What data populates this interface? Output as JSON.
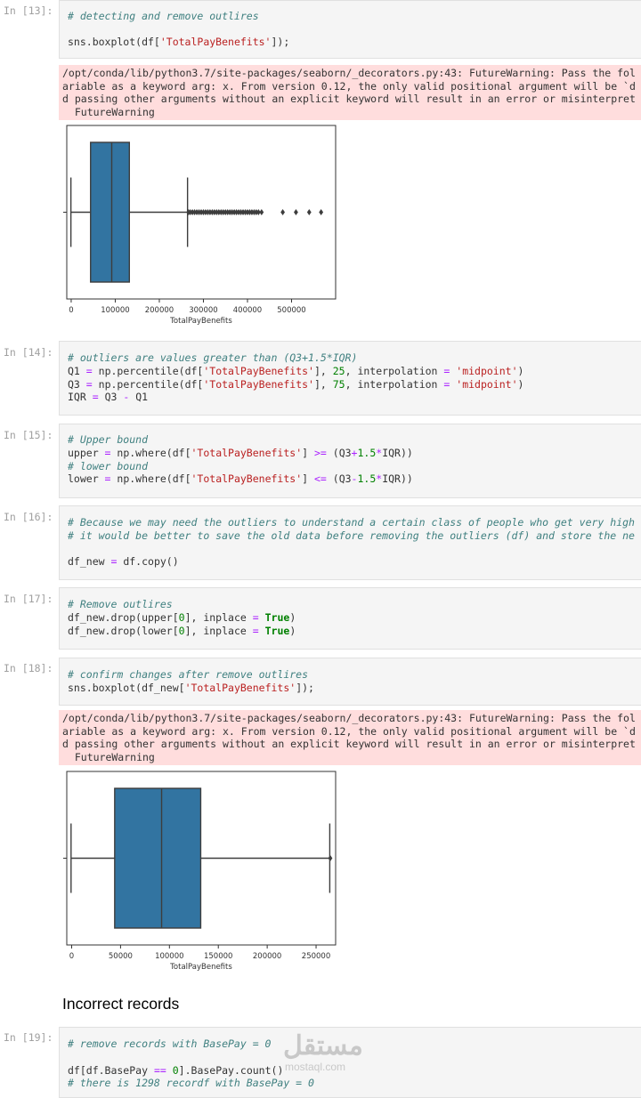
{
  "cells": {
    "c13": {
      "prompt": "In [13]:",
      "comment": "# detecting and remove outlires",
      "code_pre": "sns.boxplot(df[",
      "code_str": "'TotalPayBenefits'",
      "code_post": "]);"
    },
    "warning1": {
      "line1": "/opt/conda/lib/python3.7/site-packages/seaborn/_decorators.py:43: FutureWarning: Pass the fol",
      "line2": "ariable as a keyword arg: x. From version 0.12, the only valid positional argument will be `d",
      "line3": "d passing other arguments without an explicit keyword will result in an error or misinterpret",
      "line4": "  FutureWarning"
    },
    "c14": {
      "prompt": "In [14]:",
      "comment": "# outliers are values greater than (Q3+1.5*IQR)",
      "l2a": "Q1 ",
      "l2b": "=",
      "l2c": " np.percentile(df[",
      "l2d": "'TotalPayBenefits'",
      "l2e": "], ",
      "l2f": "25",
      "l2g": ", interpolation ",
      "l2h": "=",
      "l2i": " ",
      "l2j": "'midpoint'",
      "l2k": ")",
      "l3a": "Q3 ",
      "l3b": "=",
      "l3c": " np.percentile(df[",
      "l3d": "'TotalPayBenefits'",
      "l3e": "], ",
      "l3f": "75",
      "l3g": ", interpolation ",
      "l3h": "=",
      "l3i": " ",
      "l3j": "'midpoint'",
      "l3k": ")",
      "l4a": "IQR ",
      "l4b": "=",
      "l4c": " Q3 ",
      "l4d": "-",
      "l4e": " Q1"
    },
    "c15": {
      "prompt": "In [15]:",
      "comment1": "# Upper bound",
      "l2a": "upper ",
      "l2b": "=",
      "l2c": " np.where(df[",
      "l2d": "'TotalPayBenefits'",
      "l2e": "] ",
      "l2f": ">=",
      "l2g": " (Q3",
      "l2h": "+",
      "l2i": "1.5",
      "l2j": "*",
      "l2k": "IQR))",
      "comment2": "# lower bound",
      "l4a": "lower ",
      "l4b": "=",
      "l4c": " np.where(df[",
      "l4d": "'TotalPayBenefits'",
      "l4e": "] ",
      "l4f": "<=",
      "l4g": " (Q3",
      "l4h": "-",
      "l4i": "1.5",
      "l4j": "*",
      "l4k": "IQR))"
    },
    "c16": {
      "prompt": "In [16]:",
      "comment1": "# Because we may need the outliers to understand a certain class of people who get very high",
      "comment2": "# it would be better to save the old data before removing the outliers (df) and store the ne",
      "l4a": "df_new ",
      "l4b": "=",
      "l4c": " df.copy()"
    },
    "c17": {
      "prompt": "In [17]:",
      "comment": "# Remove outlires",
      "l2a": "df_new.drop(upper[",
      "l2b": "0",
      "l2c": "], inplace ",
      "l2d": "=",
      "l2e": " ",
      "l2f": "True",
      "l2g": ")",
      "l3a": "df_new.drop(lower[",
      "l3b": "0",
      "l3c": "], inplace ",
      "l3d": "=",
      "l3e": " ",
      "l3f": "True",
      "l3g": ")"
    },
    "c18": {
      "prompt": "In [18]:",
      "comment": "# confirm changes after remove outlires",
      "code_pre": "sns.boxplot(df_new[",
      "code_str": "'TotalPayBenefits'",
      "code_post": "]);"
    },
    "warning2": {
      "line1": "/opt/conda/lib/python3.7/site-packages/seaborn/_decorators.py:43: FutureWarning: Pass the fol",
      "line2": "ariable as a keyword arg: x. From version 0.12, the only valid positional argument will be `d",
      "line3": "d passing other arguments without an explicit keyword will result in an error or misinterpret",
      "line4": "  FutureWarning"
    },
    "heading": "Incorrect records",
    "c19": {
      "prompt": "In [19]:",
      "comment1": "# remove records with BasePay = 0",
      "l3a": "df[df.BasePay ",
      "l3b": "==",
      "l3c": " ",
      "l3d": "0",
      "l3e": "].BasePay.count()",
      "comment2": "# there is 1298 recordf with BasePay = 0"
    }
  },
  "watermark": {
    "arabic": "مستقل",
    "latin": "mostaql.com"
  },
  "chart_data": [
    {
      "type": "boxplot",
      "xlabel": "TotalPayBenefits",
      "xlim": [
        -10000,
        600000
      ],
      "xticks": [
        0,
        100000,
        200000,
        300000,
        400000,
        500000
      ],
      "xtick_labels": [
        "0",
        "100000",
        "200000",
        "300000",
        "400000",
        "500000"
      ],
      "min_whisker": -618,
      "q1": 44000,
      "median": 92000,
      "q3": 132000,
      "max_whisker": 264000,
      "outliers": [
        266000,
        270000,
        275000,
        280000,
        285000,
        290000,
        295000,
        300000,
        305000,
        310000,
        315000,
        320000,
        325000,
        330000,
        335000,
        340000,
        345000,
        350000,
        355000,
        360000,
        365000,
        370000,
        375000,
        380000,
        385000,
        390000,
        395000,
        400000,
        405000,
        410000,
        415000,
        420000,
        425000,
        432000,
        480000,
        510000,
        540000,
        567000
      ],
      "box_color": "#3274a1"
    },
    {
      "type": "boxplot",
      "xlabel": "TotalPayBenefits",
      "xlim": [
        -5000,
        270000
      ],
      "xticks": [
        0,
        50000,
        100000,
        150000,
        200000,
        250000
      ],
      "xtick_labels": [
        "0",
        "50000",
        "100000",
        "150000",
        "200000",
        "250000"
      ],
      "min_whisker": -618,
      "q1": 44000,
      "median": 92000,
      "q3": 132000,
      "max_whisker": 264000,
      "outliers": [
        264500
      ],
      "box_color": "#3274a1"
    }
  ]
}
